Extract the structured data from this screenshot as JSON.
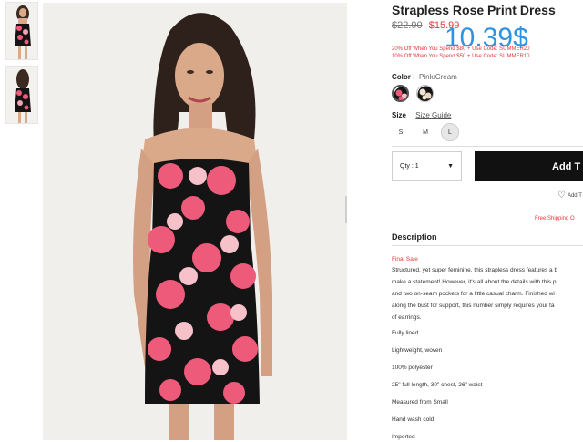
{
  "product": {
    "title": "Strapless Rose Print Dress",
    "original_price": "$22.90",
    "sale_price": "$15.99",
    "overlay_price": "10.39$",
    "promos": [
      "20% Off When You Spend $80 + Use Code: SUMMER20",
      "10% Off When You Spend $50 + Use Code: SUMMER10"
    ]
  },
  "color": {
    "label": "Color :",
    "value": "Pink/Cream",
    "swatches": [
      "pink-cream-swatch",
      "black-cream-swatch"
    ]
  },
  "size": {
    "label": "Size",
    "guide_label": "Size Guide",
    "options": [
      "S",
      "M",
      "L"
    ],
    "selected": "L"
  },
  "purchase": {
    "qty_label": "Qty : 1",
    "qty_arrow": "▼",
    "add_label": "Add T",
    "wishlist_label": "Add T",
    "shipping_label": "Free Shipping O"
  },
  "description": {
    "title": "Description",
    "final_sale": "Final Sale",
    "body_lines": [
      "Structured, yet super feminine, this strapless dress features a b",
      "make a statement! However, it's all about the details with this p",
      "and two on-seam pockets for a little casual charm. Finished wi",
      "along the bust for support, this number simply requires your fa",
      "of earrings."
    ],
    "specs": [
      "Fully lined",
      "Lightweight, woven",
      "100% polyester",
      "25\" full length, 30\" chest, 26\" waist",
      "Measured from Small",
      "Hand wash cold",
      "Imported"
    ]
  },
  "colors": {
    "accent_red": "#e13b3b",
    "overlay_blue": "#2f93e0",
    "button_black": "#111111",
    "dress_pink": "#ee5a7a",
    "dress_black": "#141414"
  }
}
